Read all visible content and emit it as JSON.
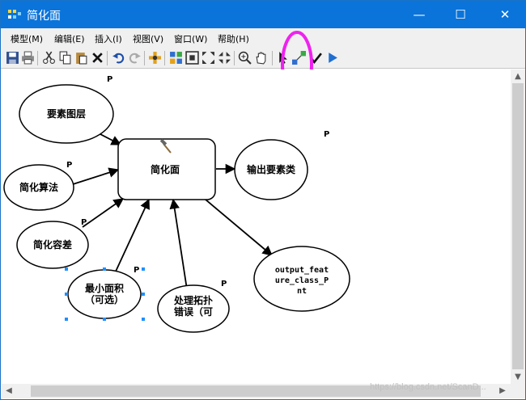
{
  "window": {
    "title": "简化面",
    "controls": {
      "minimize": "—",
      "maximize": "☐",
      "close": "✕"
    }
  },
  "menu": {
    "items": [
      {
        "label": "模型(M)"
      },
      {
        "label": "编辑(E)"
      },
      {
        "label": "插入(I)"
      },
      {
        "label": "视图(V)"
      },
      {
        "label": "窗口(W)"
      },
      {
        "label": "帮助(H)"
      }
    ]
  },
  "toolbar": {
    "buttons": [
      "save-icon",
      "print-icon",
      "cut-icon",
      "copy-icon",
      "paste-icon",
      "delete-icon",
      "undo-icon",
      "redo-icon",
      "add-data-icon",
      "auto-layout-icon",
      "full-extent-icon",
      "fixed-zoom-in-icon",
      "fixed-zoom-out-icon",
      "zoom-in-icon",
      "pan-icon",
      "select-icon",
      "connect-icon",
      "validate-icon",
      "run-icon"
    ],
    "highlight_color": "#ee22ee"
  },
  "diagram": {
    "nodes": {
      "input_layer": "要素图层",
      "algorithm": "简化算法",
      "tolerance": "简化容差",
      "min_area_line1": "最小面积",
      "min_area_line2": "（可选）",
      "topology_line1": "处理拓扑",
      "topology_line2": "错误（可",
      "tool": "简化面",
      "output_class": "输出要素类",
      "output_fc_line1": "output_feat",
      "output_fc_line2": "ure_class_P",
      "output_fc_line3": "nt"
    },
    "param_marker": "P"
  },
  "watermark": "https://blog.csdn.net/ScanD..."
}
